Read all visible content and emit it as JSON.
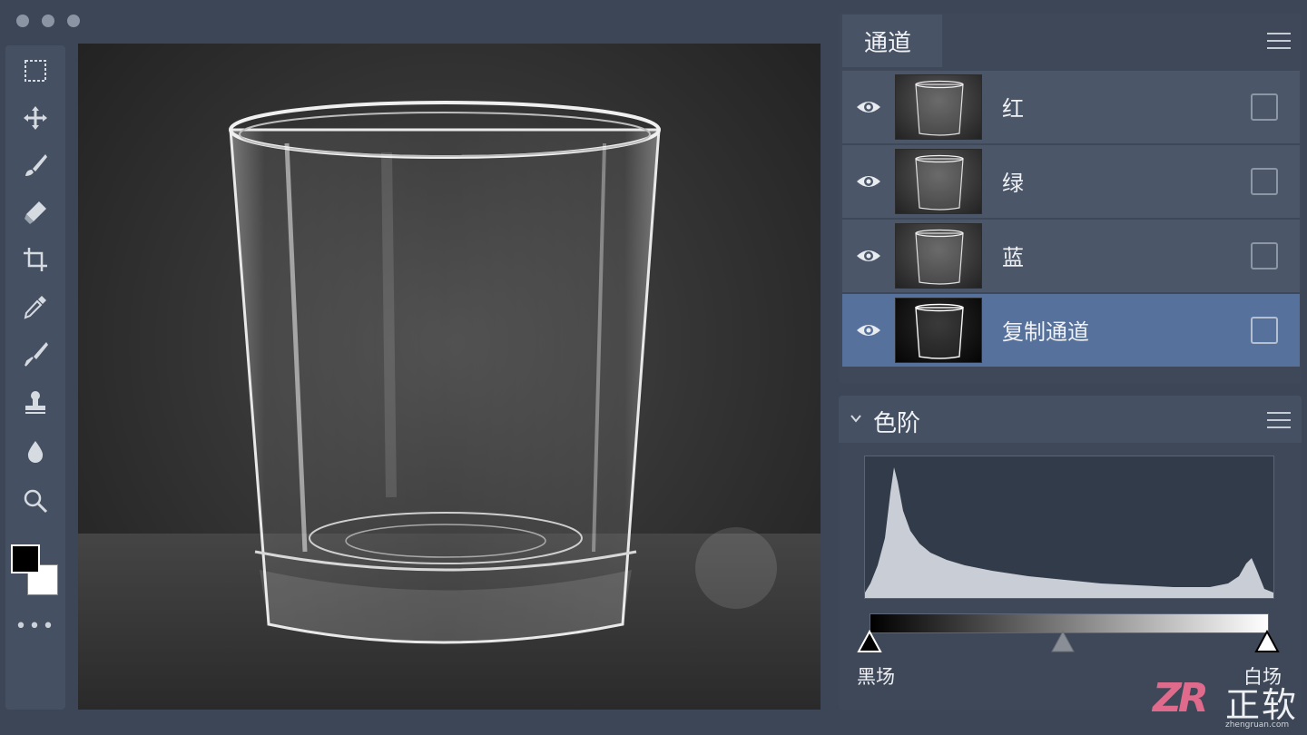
{
  "channels_panel": {
    "tab_label": "通道",
    "channels": [
      {
        "name": "红",
        "visible": true,
        "selected": false,
        "checked": false
      },
      {
        "name": "绿",
        "visible": true,
        "selected": false,
        "checked": false
      },
      {
        "name": "蓝",
        "visible": true,
        "selected": false,
        "checked": false
      },
      {
        "name": "复制通道",
        "visible": true,
        "selected": true,
        "checked": false
      }
    ]
  },
  "levels_panel": {
    "title": "色阶",
    "black_point_label": "黑场",
    "white_point_label": "白场"
  },
  "toolbar": {
    "tools": [
      "marquee-icon",
      "move-icon",
      "brush-icon",
      "eraser-icon",
      "crop-icon",
      "eyedropper-icon",
      "paintbrush-icon",
      "stamp-icon",
      "blur-drop-icon",
      "zoom-icon"
    ],
    "foreground_color": "#000000",
    "background_color": "#ffffff",
    "more_label": "•••"
  },
  "colors": {
    "selected_row": "#56719b",
    "panel_bg": "#3e4858",
    "app_bg": "#3c4656"
  },
  "watermark": {
    "logo": "ZR",
    "text": "正软",
    "url": "zhengruan.com"
  }
}
